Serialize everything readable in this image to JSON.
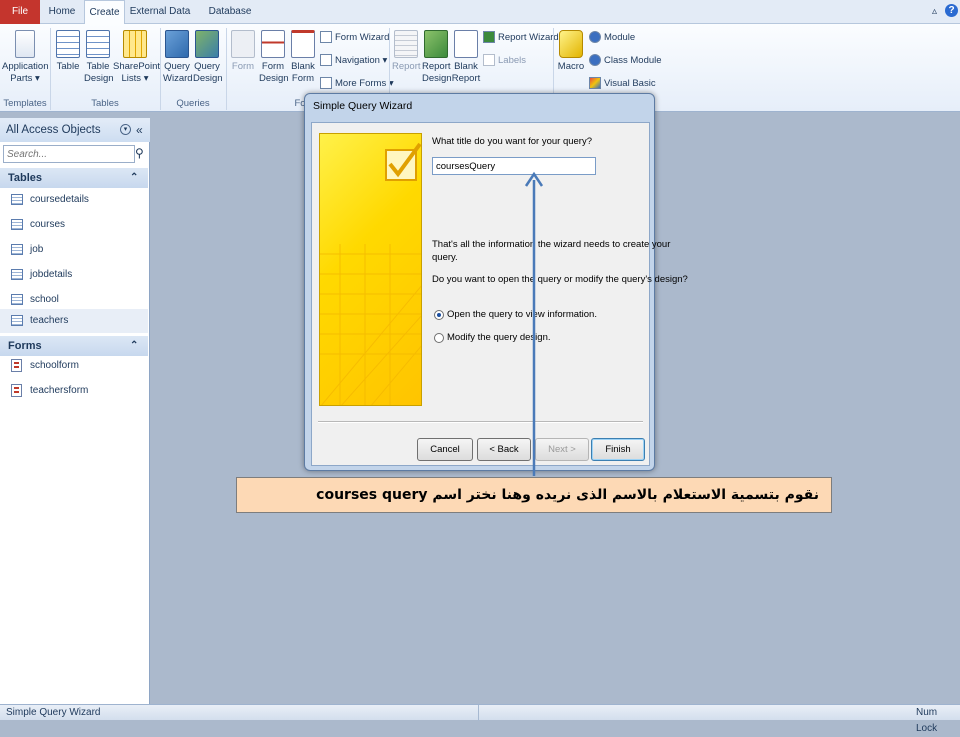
{
  "tabs": {
    "file": "File",
    "home": "Home",
    "create": "Create",
    "external": "External Data",
    "dbtools": "Database Tools"
  },
  "ribbon": {
    "templates": {
      "label": "Templates",
      "app_parts": "Application Parts ▾"
    },
    "tables": {
      "label": "Tables",
      "table": "Table",
      "table_design": "Table Design",
      "sharepoint": "SharePoint Lists ▾"
    },
    "queries": {
      "label": "Queries",
      "wizard": "Query Wizard",
      "design": "Query Design"
    },
    "forms": {
      "label": "Fo",
      "form": "Form",
      "form_design": "Form Design",
      "blank_form": "Blank Form",
      "form_wizard": "Form Wizard",
      "navigation": "Navigation ▾",
      "more_forms": "More Forms ▾"
    },
    "reports": {
      "report": "Report",
      "report_design": "Report Design",
      "blank_report": "Blank Report",
      "report_wizard": "Report Wizard",
      "labels": "Labels"
    },
    "macros": {
      "macro": "Macro",
      "module": "Module",
      "class_module": "Class Module",
      "visual_basic": "Visual Basic"
    }
  },
  "nav_pane": {
    "title": "All Access Objects",
    "search_placeholder": "Search...",
    "tables_header": "Tables",
    "tables": [
      "coursedetails",
      "courses",
      "job",
      "jobdetails",
      "school",
      "teachers"
    ],
    "forms_header": "Forms",
    "forms": [
      "schoolform",
      "teachersform"
    ]
  },
  "dialog": {
    "title": "Simple Query Wizard",
    "question": "What title do you want for your query?",
    "query_name": "coursesQuery",
    "info_line1": "That's all the information the wizard needs to create your",
    "info_line2": "query.",
    "open_or_modify": "Do you want to open the query or modify the query's design?",
    "option_open": "Open the query to view information.",
    "option_modify": "Modify the query design.",
    "cancel": "Cancel",
    "back": "< Back",
    "next": "Next >",
    "finish": "Finish"
  },
  "callout": "نقوم بتسمية الاستعلام بالاسم الذى نريده وهنا نختر اسم  courses query",
  "status": {
    "left": "Simple Query Wizard",
    "right": "Num Lock"
  },
  "colors": {
    "file_tab": "#c4352d",
    "callout_bg": "#fdd9b5",
    "arrow": "#4a7ab8"
  }
}
